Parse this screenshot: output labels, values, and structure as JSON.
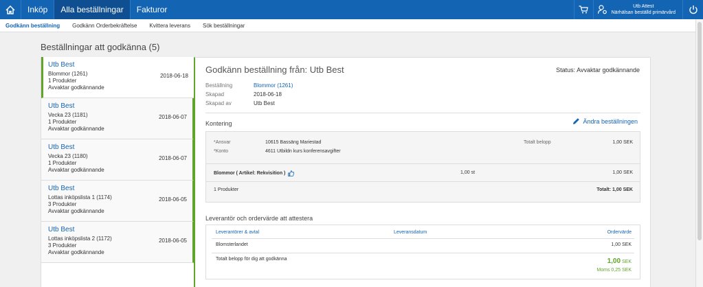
{
  "topbar": {
    "nav": [
      "Inköp",
      "Alla beställningar",
      "Fakturor"
    ],
    "user_name": "Utb Attest",
    "user_unit": "Närhälsan beställd primärvård"
  },
  "subnav": [
    "Godkänn beställning",
    "Godkänn Orderbekräftelse",
    "Kvittera leverans",
    "Sök beställningar"
  ],
  "page_title": "Beställningar att godkänna (5)",
  "orders": [
    {
      "name": "Utb Best",
      "ref": "Blommor (1261)",
      "products": "1 Produkter",
      "status": "Avvaktar godkännande",
      "date": "2018-06-18"
    },
    {
      "name": "Utb Best",
      "ref": "Vecka 23 (1181)",
      "products": "1 Produkter",
      "status": "Avvaktar godkännande",
      "date": "2018-06-07"
    },
    {
      "name": "Utb Best",
      "ref": "Vecka 23 (1180)",
      "products": "1 Produkter",
      "status": "Avvaktar godkännande",
      "date": "2018-06-07"
    },
    {
      "name": "Utb Best",
      "ref": "Lottas inköpslista 1 (1174)",
      "products": "3 Produkter",
      "status": "Avvaktar godkännande",
      "date": "2018-06-05"
    },
    {
      "name": "Utb Best",
      "ref": "Lottas inköpslista 2 (1172)",
      "products": "3 Produkter",
      "status": "Avvaktar godkännande",
      "date": "2018-06-05"
    }
  ],
  "detail": {
    "title": "Godkänn beställning från: Utb Best",
    "status": "Status: Avvaktar godkännande",
    "meta": {
      "order_label": "Beställning",
      "order_value": "Blommor (1261)",
      "created_label": "Skapad",
      "created_value": "2018-06-18",
      "by_label": "Skapad av",
      "by_value": "Utb Best"
    },
    "kontering_title": "Kontering",
    "edit_label": "Ändra beställningen",
    "kontering": {
      "ansvar_label": "*Ansvar",
      "ansvar_value": "10615 Bassäng Mariestad",
      "konto_label": "*Konto",
      "konto_value": "4611 Utbildn kurs konferensavgifter",
      "total_label": "Totalt belopp",
      "total_value": "1,00 SEK",
      "product_name": "Blommor ( Artikel: Rekvisition )",
      "product_qty": "1,00 st",
      "product_sum": "1,00 SEK",
      "product_count": "1 Produkter",
      "grand_total": "Totalt: 1,00 SEK"
    },
    "supplier_title": "Leverantör och ordervärde att attestera",
    "supplier": {
      "col_supplier": "Leverantörer & avtal",
      "col_date": "Leveransdatum",
      "col_value": "Ordervärde",
      "supplier_name": "Blomsterlandet",
      "supplier_value": "1,00 SEK",
      "total_label": "Totalt belopp för dig att godkänna",
      "total_amount": "1,00",
      "total_currency": "SEK",
      "vat": "Moms 0,25 SEK"
    }
  }
}
